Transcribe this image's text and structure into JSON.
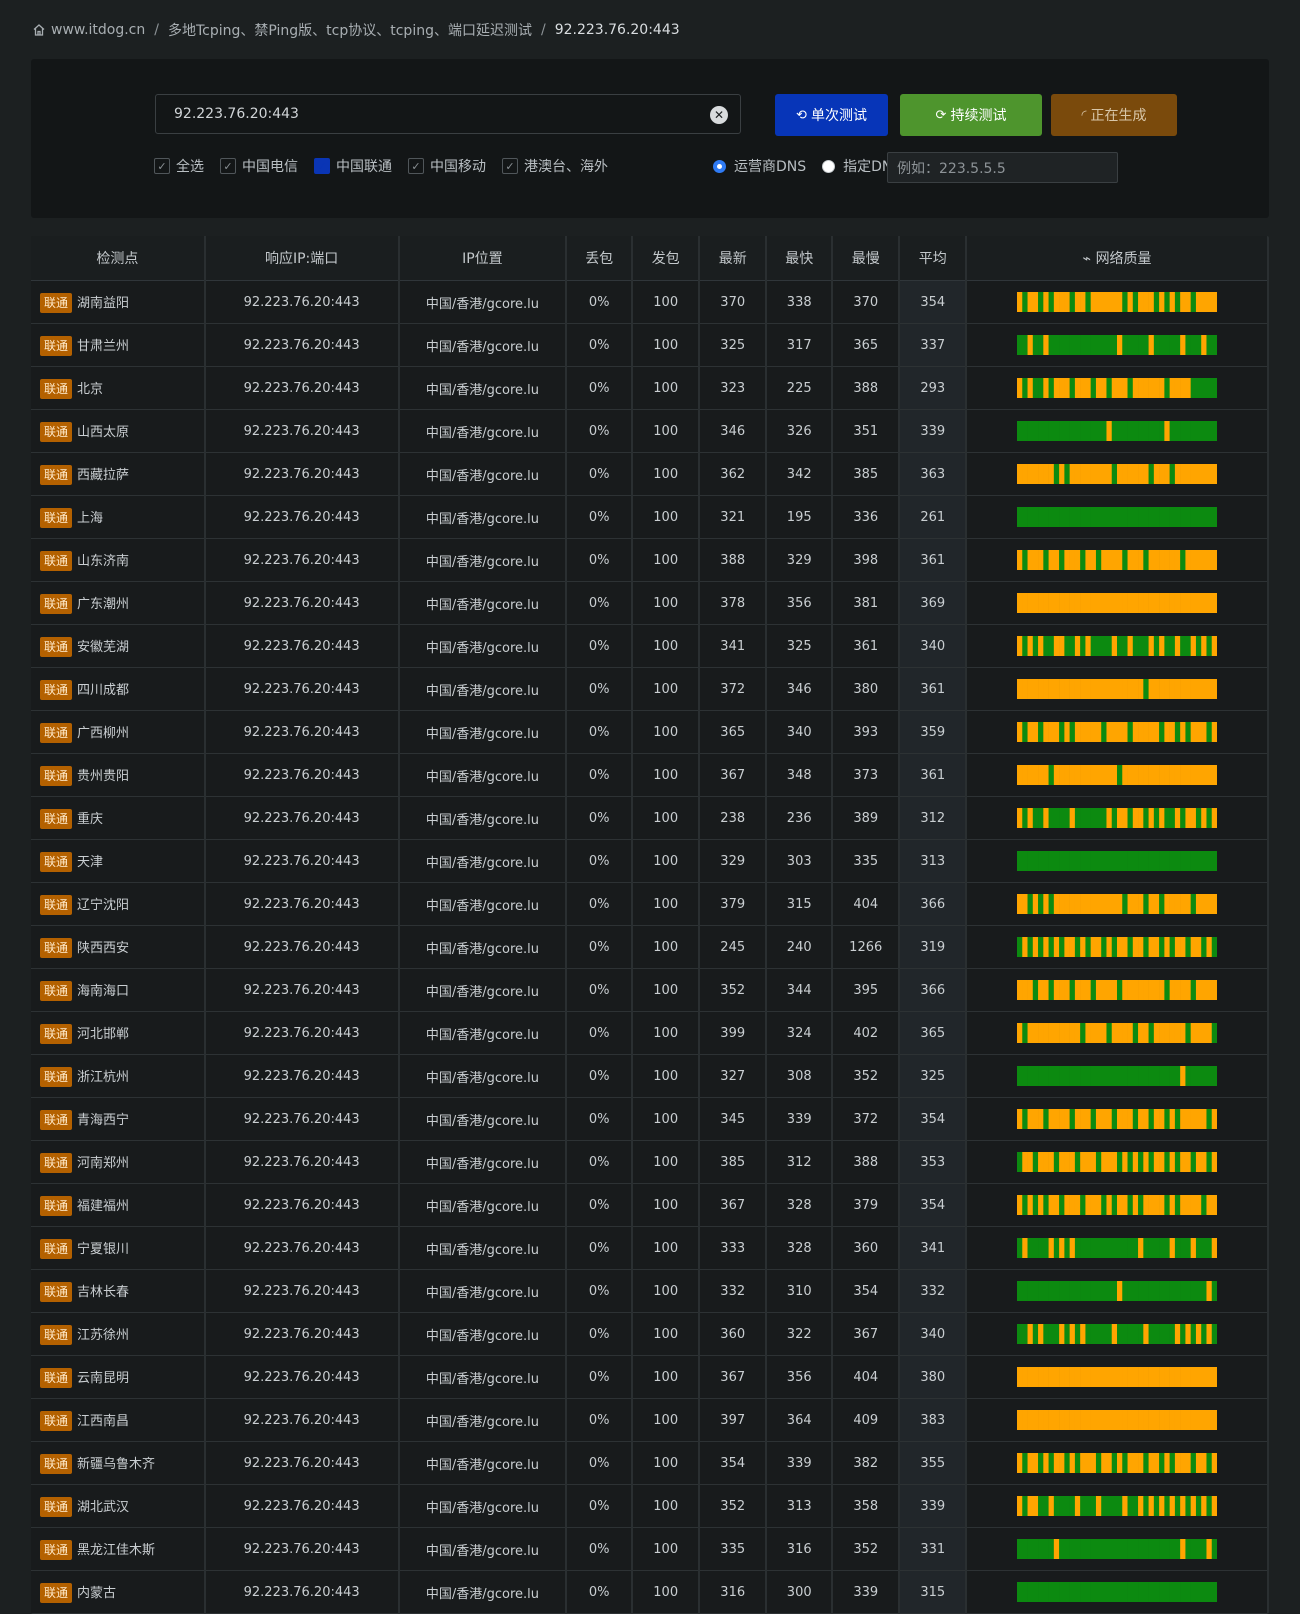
{
  "breadcrumb": {
    "site": "www.itdog.cn",
    "section": "多地Tcping、禁Ping版、tcp协议、tcping、端口延迟测试",
    "current": "92.223.76.20:443"
  },
  "search": {
    "value": "92.223.76.20:443",
    "clear_icon": "clear-icon"
  },
  "buttons": {
    "single": "单次测试",
    "continuous": "持续测试",
    "generating": "正在生成"
  },
  "filters": {
    "all": "全选",
    "telecom": "中国电信",
    "unicom": "中国联通",
    "mobile": "中国移动",
    "overseas": "港澳台、海外"
  },
  "dns": {
    "isp_label": "运营商DNS",
    "custom_label": "指定DNS:",
    "placeholder": "例如：223.5.5.5"
  },
  "colors": {
    "good": "#0c8a10",
    "slow": "#ffa500",
    "tag": "#b46100"
  },
  "table": {
    "headers": {
      "location": "检测点",
      "ip": "响应IP:端口",
      "geo": "IP位置",
      "loss": "丢包",
      "sent": "发包",
      "latest": "最新",
      "fastest": "最快",
      "slowest": "最慢",
      "average": "平均",
      "quality": "网络质量"
    },
    "rows": [
      {
        "tag": "联通",
        "loc": "湖南益阳",
        "ip": "92.223.76.20:443",
        "geo": "中国/香港/gcore.lu",
        "loss": "0%",
        "sent": "100",
        "latest": "370",
        "fastest": "338",
        "slowest": "370",
        "avg": "354",
        "q": "YGYYGYGYYYGYYGYYYYYYGYGYYYGYGYGYYGYYYY"
      },
      {
        "tag": "联通",
        "loc": "甘肃兰州",
        "ip": "92.223.76.20:443",
        "geo": "中国/香港/gcore.lu",
        "loss": "0%",
        "sent": "100",
        "latest": "325",
        "fastest": "317",
        "slowest": "365",
        "avg": "337",
        "q": "GGYGGYGGGGGGGGGGGGGYGGGGGYGGGGGYGGGYGG"
      },
      {
        "tag": "联通",
        "loc": "北京",
        "ip": "92.223.76.20:443",
        "geo": "中国/香港/gcore.lu",
        "loss": "0%",
        "sent": "100",
        "latest": "323",
        "fastest": "225",
        "slowest": "388",
        "avg": "293",
        "q": "YGYGGYGYYYGYYYGYYGYYYGYYYYYYGYYYYGGGGG"
      },
      {
        "tag": "联通",
        "loc": "山西太原",
        "ip": "92.223.76.20:443",
        "geo": "中国/香港/gcore.lu",
        "loss": "0%",
        "sent": "100",
        "latest": "346",
        "fastest": "326",
        "slowest": "351",
        "avg": "339",
        "q": "GGGGGGGGGGGGGGGGGYGGGGGGGGGGYGGGGGGGGG"
      },
      {
        "tag": "联通",
        "loc": "西藏拉萨",
        "ip": "92.223.76.20:443",
        "geo": "中国/香港/gcore.lu",
        "loss": "0%",
        "sent": "100",
        "latest": "362",
        "fastest": "342",
        "slowest": "385",
        "avg": "363",
        "q": "YYYYYYYGYGYYYYYYYYGYYYYYYGYYYGYYYYYYYY"
      },
      {
        "tag": "联通",
        "loc": "上海",
        "ip": "92.223.76.20:443",
        "geo": "中国/香港/gcore.lu",
        "loss": "0%",
        "sent": "100",
        "latest": "321",
        "fastest": "195",
        "slowest": "336",
        "avg": "261",
        "q": "GGGGGGGGGGGGGGGGGGGGGGGGGGGGGGGGGGGGGG"
      },
      {
        "tag": "联通",
        "loc": "山东济南",
        "ip": "92.223.76.20:443",
        "geo": "中国/香港/gcore.lu",
        "loss": "0%",
        "sent": "100",
        "latest": "388",
        "fastest": "329",
        "slowest": "398",
        "avg": "361",
        "q": "YGYYYGYYGYYYGYYGYYYYGYYYGYYYYYYGYYYYYY"
      },
      {
        "tag": "联通",
        "loc": "广东潮州",
        "ip": "92.223.76.20:443",
        "geo": "中国/香港/gcore.lu",
        "loss": "0%",
        "sent": "100",
        "latest": "378",
        "fastest": "356",
        "slowest": "381",
        "avg": "369",
        "q": "YYYYYYYYYYYYYYYYYYYYYYYYYYYYYYYYYYYYYY"
      },
      {
        "tag": "联通",
        "loc": "安徽芜湖",
        "ip": "92.223.76.20:443",
        "geo": "中国/香港/gcore.lu",
        "loss": "0%",
        "sent": "100",
        "latest": "341",
        "fastest": "325",
        "slowest": "361",
        "avg": "340",
        "q": "YGYGYGGYYGGYGYGGGGYGGYGGGYGYGGYGGYGYGY"
      },
      {
        "tag": "联通",
        "loc": "四川成都",
        "ip": "92.223.76.20:443",
        "geo": "中国/香港/gcore.lu",
        "loss": "0%",
        "sent": "100",
        "latest": "372",
        "fastest": "346",
        "slowest": "380",
        "avg": "361",
        "q": "YYYYYYYYYYYYYYYYYYYYYYYYGYYYYYYYYYYYYY"
      },
      {
        "tag": "联通",
        "loc": "广西柳州",
        "ip": "92.223.76.20:443",
        "geo": "中国/香港/gcore.lu",
        "loss": "0%",
        "sent": "100",
        "latest": "365",
        "fastest": "340",
        "slowest": "393",
        "avg": "359",
        "q": "YGYYGYYYGYGYYYYYGYYYYGYYYYYGYYGYGYYYGY"
      },
      {
        "tag": "联通",
        "loc": "贵州贵阳",
        "ip": "92.223.76.20:443",
        "geo": "中国/香港/gcore.lu",
        "loss": "0%",
        "sent": "100",
        "latest": "367",
        "fastest": "348",
        "slowest": "373",
        "avg": "361",
        "q": "YYYYYYGYYYYYYYYYYYYGYYYYYYYYYYYYYYYYYY"
      },
      {
        "tag": "联通",
        "loc": "重庆",
        "ip": "92.223.76.20:443",
        "geo": "中国/香港/gcore.lu",
        "loss": "0%",
        "sent": "100",
        "latest": "238",
        "fastest": "236",
        "slowest": "389",
        "avg": "312",
        "q": "YGYGGYGGGGYGGGGGGYGYYGYYGYGYGGYGYYGYGY"
      },
      {
        "tag": "联通",
        "loc": "天津",
        "ip": "92.223.76.20:443",
        "geo": "中国/香港/gcore.lu",
        "loss": "0%",
        "sent": "100",
        "latest": "329",
        "fastest": "303",
        "slowest": "335",
        "avg": "313",
        "q": "GGGGGGGGGGGGGGGGGGGGGGGGGGGGGGGGGGGGGG"
      },
      {
        "tag": "联通",
        "loc": "辽宁沈阳",
        "ip": "92.223.76.20:443",
        "geo": "中国/香港/gcore.lu",
        "loss": "0%",
        "sent": "100",
        "latest": "379",
        "fastest": "315",
        "slowest": "404",
        "avg": "366",
        "q": "YYGYGYGYYYYYYYYYYYYYGYYYGYYGYYYYYGYYYY"
      },
      {
        "tag": "联通",
        "loc": "陕西西安",
        "ip": "92.223.76.20:443",
        "geo": "中国/香港/gcore.lu",
        "loss": "0%",
        "sent": "100",
        "latest": "245",
        "fastest": "240",
        "slowest": "1266",
        "avg": "319",
        "q": "GYGYGYGYGYYGYGYYGYGYYGYYGYYGYGYYGYYGYG"
      },
      {
        "tag": "联通",
        "loc": "海南海口",
        "ip": "92.223.76.20:443",
        "geo": "中国/香港/gcore.lu",
        "loss": "0%",
        "sent": "100",
        "latest": "352",
        "fastest": "344",
        "slowest": "395",
        "avg": "366",
        "q": "YYYGYYGYYYGYYYGYYYYGYYYYYYYYGYYYYGYYYY"
      },
      {
        "tag": "联通",
        "loc": "河北邯郸",
        "ip": "92.223.76.20:443",
        "geo": "中国/香港/gcore.lu",
        "loss": "0%",
        "sent": "100",
        "latest": "399",
        "fastest": "324",
        "slowest": "402",
        "avg": "365",
        "q": "YGYYYYYYYYYYGYYYYGYYYYGYYGYYYYYYGYYYYG"
      },
      {
        "tag": "联通",
        "loc": "浙江杭州",
        "ip": "92.223.76.20:443",
        "geo": "中国/香港/gcore.lu",
        "loss": "0%",
        "sent": "100",
        "latest": "327",
        "fastest": "308",
        "slowest": "352",
        "avg": "325",
        "q": "GGGGGGGGGGGGGGGGGGGGGGGGGGGGGGGYGGGGGG"
      },
      {
        "tag": "联通",
        "loc": "青海西宁",
        "ip": "92.223.76.20:443",
        "geo": "中国/香港/gcore.lu",
        "loss": "0%",
        "sent": "100",
        "latest": "345",
        "fastest": "339",
        "slowest": "372",
        "avg": "354",
        "q": "YGYYYGYYYYGYYYGYYYGYYYGYYGYYGYGYYYYYGY"
      },
      {
        "tag": "联通",
        "loc": "河南郑州",
        "ip": "92.223.76.20:443",
        "geo": "中国/香港/gcore.lu",
        "loss": "0%",
        "sent": "100",
        "latest": "385",
        "fastest": "312",
        "slowest": "388",
        "avg": "353",
        "q": "GYYGYYYGYYYGYYYGYYYGYGYGYGYYGYGYYGYYGY"
      },
      {
        "tag": "联通",
        "loc": "福建福州",
        "ip": "92.223.76.20:443",
        "geo": "中国/香港/gcore.lu",
        "loss": "0%",
        "sent": "100",
        "latest": "367",
        "fastest": "328",
        "slowest": "379",
        "avg": "354",
        "q": "YGYGYGYYGYYYGYYYGYGYYGYGYYYYGYGYYYYGYY"
      },
      {
        "tag": "联通",
        "loc": "宁夏银川",
        "ip": "92.223.76.20:443",
        "geo": "中国/香港/gcore.lu",
        "loss": "0%",
        "sent": "100",
        "latest": "333",
        "fastest": "328",
        "slowest": "360",
        "avg": "341",
        "q": "GYGGGGYGYGYGGGGGGGGGGGGYGGGGGYGGGYGGGY"
      },
      {
        "tag": "联通",
        "loc": "吉林长春",
        "ip": "92.223.76.20:443",
        "geo": "中国/香港/gcore.lu",
        "loss": "0%",
        "sent": "100",
        "latest": "332",
        "fastest": "310",
        "slowest": "354",
        "avg": "332",
        "q": "GGGGGGGGGGGGGGGGGGGYGGGGGGGGGGGGGGGGYG"
      },
      {
        "tag": "联通",
        "loc": "江苏徐州",
        "ip": "92.223.76.20:443",
        "geo": "中国/香港/gcore.lu",
        "loss": "0%",
        "sent": "100",
        "latest": "360",
        "fastest": "322",
        "slowest": "367",
        "avg": "340",
        "q": "GGYGYGGGYGYGYGGGGGYGGGGGYGGGGGYGYGYGYG"
      },
      {
        "tag": "联通",
        "loc": "云南昆明",
        "ip": "92.223.76.20:443",
        "geo": "中国/香港/gcore.lu",
        "loss": "0%",
        "sent": "100",
        "latest": "367",
        "fastest": "356",
        "slowest": "404",
        "avg": "380",
        "q": "YYYYYYYYYYYYYYYYYYYYYYYYYYYYYYYYYYYYYY"
      },
      {
        "tag": "联通",
        "loc": "江西南昌",
        "ip": "92.223.76.20:443",
        "geo": "中国/香港/gcore.lu",
        "loss": "0%",
        "sent": "100",
        "latest": "397",
        "fastest": "364",
        "slowest": "409",
        "avg": "383",
        "q": "YYYYYYYYYYYYYYYYYYYYYYYYYYYYYYYYYYYYYY"
      },
      {
        "tag": "联通",
        "loc": "新疆乌鲁木齐",
        "ip": "92.223.76.20:443",
        "geo": "中国/香港/gcore.lu",
        "loss": "0%",
        "sent": "100",
        "latest": "354",
        "fastest": "339",
        "slowest": "382",
        "avg": "355",
        "q": "YGYYGYGYYGYGYYYGYYGYGYYYGYYGYGYYYGYYGY"
      },
      {
        "tag": "联通",
        "loc": "湖北武汉",
        "ip": "92.223.76.20:443",
        "geo": "中国/香港/gcore.lu",
        "loss": "0%",
        "sent": "100",
        "latest": "352",
        "fastest": "313",
        "slowest": "358",
        "avg": "339",
        "q": "YGYYGGYGGGGYGGGYGGGGYGGYGYGYGYGYGYGYGY"
      },
      {
        "tag": "联通",
        "loc": "黑龙江佳木斯",
        "ip": "92.223.76.20:443",
        "geo": "中国/香港/gcore.lu",
        "loss": "0%",
        "sent": "100",
        "latest": "335",
        "fastest": "316",
        "slowest": "352",
        "avg": "331",
        "q": "GGGGGGGYGGGGGGGGGGGGGGGGGGGGGGGYGGGGYG"
      },
      {
        "tag": "联通",
        "loc": "内蒙古",
        "ip": "92.223.76.20:443",
        "geo": "中国/香港/gcore.lu",
        "loss": "0%",
        "sent": "100",
        "latest": "316",
        "fastest": "300",
        "slowest": "339",
        "avg": "315",
        "q": "GGGGGGGGGGGGGGGGGGGGGGGGGGGGGGGGGGGGGG"
      }
    ]
  }
}
